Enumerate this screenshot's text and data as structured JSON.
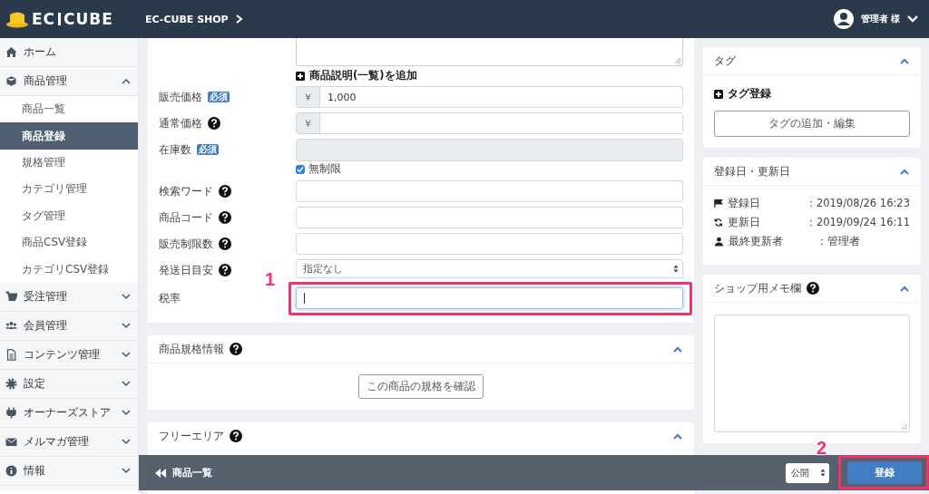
{
  "header": {
    "logo": [
      "EC",
      "CUBE"
    ],
    "shop_name": "EC-CUBE SHOP",
    "user": "管理者 様"
  },
  "sidebar": {
    "items": [
      {
        "label": "ホーム",
        "kind": "link"
      },
      {
        "label": "商品管理",
        "kind": "group",
        "expanded": true,
        "children": [
          {
            "label": "商品一覧",
            "selected": false
          },
          {
            "label": "商品登録",
            "selected": true
          },
          {
            "label": "規格管理",
            "selected": false
          },
          {
            "label": "カテゴリ管理",
            "selected": false
          },
          {
            "label": "タグ管理",
            "selected": false
          },
          {
            "label": "商品CSV登録",
            "selected": false
          },
          {
            "label": "カテゴリCSV登録",
            "selected": false
          }
        ]
      },
      {
        "label": "受注管理",
        "kind": "group",
        "expanded": false
      },
      {
        "label": "会員管理",
        "kind": "group",
        "expanded": false
      },
      {
        "label": "コンテンツ管理",
        "kind": "group",
        "expanded": false
      },
      {
        "label": "設定",
        "kind": "group",
        "expanded": false
      },
      {
        "label": "オーナーズストア",
        "kind": "group",
        "expanded": false
      },
      {
        "label": "メルマガ管理",
        "kind": "group",
        "expanded": false
      },
      {
        "label": "情報",
        "kind": "group",
        "expanded": false
      }
    ]
  },
  "product_form": {
    "description_toggle": "商品説明(一覧)を追加",
    "rows": [
      {
        "label": "販売価格",
        "badge": "必須",
        "help": false,
        "kind": "yen",
        "currency": "￥",
        "value": "1,000"
      },
      {
        "label": "通常価格",
        "help": true,
        "kind": "yen",
        "currency": "￥"
      },
      {
        "label": "在庫数",
        "badge": "必須",
        "help": false,
        "kind": "disabled",
        "checkbox": {
          "label": "無制限",
          "checked": true
        }
      },
      {
        "label": "検索ワード",
        "help": true,
        "kind": "text"
      },
      {
        "label": "商品コード",
        "help": true,
        "kind": "text"
      },
      {
        "label": "販売制限数",
        "help": true,
        "kind": "text"
      },
      {
        "label": "発送日目安",
        "help": true,
        "kind": "select",
        "value": "指定なし"
      },
      {
        "label": "税率",
        "help": false,
        "kind": "text",
        "focused": true,
        "annotation": "1"
      }
    ]
  },
  "spec_card": {
    "title": "商品規格情報",
    "help": true,
    "expanded": true,
    "button": "この商品の規格を確認"
  },
  "free_area_card": {
    "title": "フリーエリア",
    "help": true,
    "expanded": true
  },
  "tag_card": {
    "title": "タグ",
    "expanded": true,
    "add_label": "タグ登録",
    "button": "タグの追加・編集"
  },
  "dates_card": {
    "title": "登録日・更新日",
    "expanded": true,
    "rows": [
      {
        "label": "登録日",
        "value": "：2019/08/26 16:23"
      },
      {
        "label": "更新日",
        "value": "：2019/09/24 16:11"
      },
      {
        "label": "最終更新者",
        "value": "：管理者"
      }
    ]
  },
  "memo_card": {
    "title": "ショップ用メモ欄",
    "help": true,
    "expanded": true
  },
  "footer": {
    "back": "商品一覧",
    "status": "公開",
    "submit": "登録",
    "annotation": "2"
  }
}
